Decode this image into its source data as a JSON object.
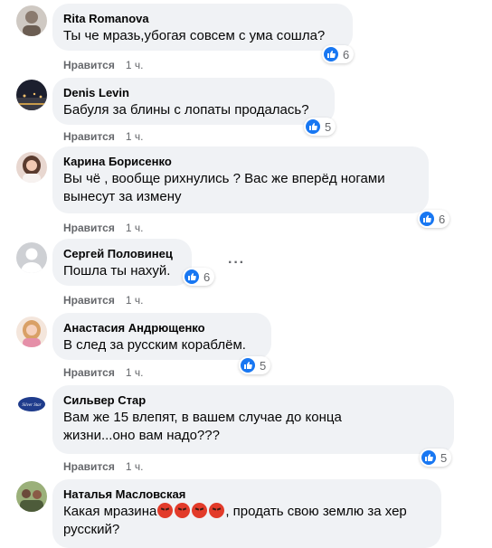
{
  "like_label": "Нравится",
  "comments": [
    {
      "name": "Rita Romanova",
      "text": "Ты че мразь,убогая совсем с ума сошла?",
      "time": "1 ч.",
      "reactions": "6"
    },
    {
      "name": "Denis Levin",
      "text": "Бабуля за блины с лопаты продалась?",
      "time": "1 ч.",
      "reactions": "5"
    },
    {
      "name": "Карина Борисенко",
      "text": "Вы чё , вообще рихнулись ? Вас же вперёд ногами вынесут за измену",
      "time": "1 ч.",
      "reactions": "6"
    },
    {
      "name": "Сергей Половинец",
      "text": "Пошла ты нахуй.",
      "time": "1 ч.",
      "reactions": "6"
    },
    {
      "name": "Анастасия Андрющенко",
      "text": "В след за русским кораблём.",
      "time": "1 ч.",
      "reactions": "5"
    },
    {
      "name": "Сильвер Стар",
      "text": "Вам же 15 влепят, в вашем случае до конца жизни...оно вам надо???",
      "time": "1 ч.",
      "reactions": "5"
    },
    {
      "name": "Наталья Масловская",
      "text_before_emoji": "Какая мразина",
      "text_after_emoji": ", продать свою землю за хер русский?"
    }
  ],
  "colors": {
    "bubble": "#f0f2f5",
    "like_badge": "#1877f2",
    "meta": "#65676b"
  }
}
